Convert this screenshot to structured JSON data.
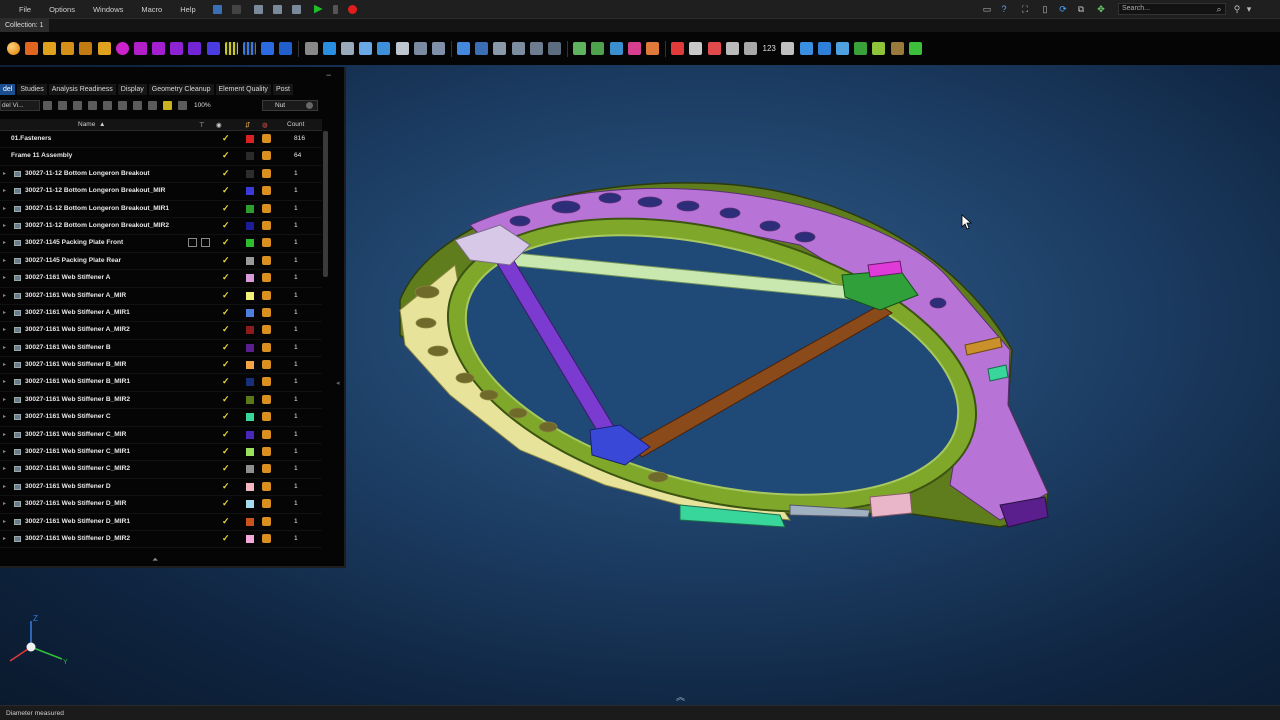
{
  "menu": {
    "file": "File",
    "options": "Options",
    "windows": "Windows",
    "macro": "Macro",
    "help": "Help"
  },
  "search": {
    "placeholder": "Search..."
  },
  "collection": {
    "label": "Collection: 1"
  },
  "panel": {
    "tabs": [
      "del",
      "Studies",
      "Analysis Readiness",
      "Display",
      "Geometry Cleanup",
      "Element Quality",
      "Post"
    ],
    "view_select": "del Vi...",
    "zoom": "100%",
    "filter_value": "Nut",
    "columns": {
      "name": "Name",
      "count": "Count"
    },
    "rows": [
      {
        "name": "01.Fasteners",
        "count": "816",
        "color": "#d8221f",
        "top": true
      },
      {
        "name": "Frame 11 Assembly",
        "count": "64",
        "color": "#2a2a2a",
        "top": true
      },
      {
        "name": "30027-11-12 Bottom Longeron Breakout",
        "count": "1",
        "color": "#2d2d2d"
      },
      {
        "name": "30027-11-12 Bottom Longeron Breakout_MIR",
        "count": "1",
        "color": "#3a3ad8"
      },
      {
        "name": "30027-11-12 Bottom Longeron Breakout_MIR1",
        "count": "1",
        "color": "#2f9c2f"
      },
      {
        "name": "30027-11-12 Bottom Longeron Breakout_MIR2",
        "count": "1",
        "color": "#1d1d9a"
      },
      {
        "name": "30027-1145 Packing Plate Front",
        "count": "1",
        "color": "#2fbd2f",
        "extra": true
      },
      {
        "name": "30027-1145 Packing Plate Rear",
        "count": "1",
        "color": "#9a9a9a"
      },
      {
        "name": "30027-1161 Web Stiffener A",
        "count": "1",
        "color": "#d79bd9"
      },
      {
        "name": "30027-1161 Web Stiffener A_MIR",
        "count": "1",
        "color": "#f2f07a"
      },
      {
        "name": "30027-1161 Web Stiffener A_MIR1",
        "count": "1",
        "color": "#4e7fdc"
      },
      {
        "name": "30027-1161 Web Stiffener A_MIR2",
        "count": "1",
        "color": "#8a1c1c"
      },
      {
        "name": "30027-1161 Web Stiffener B",
        "count": "1",
        "color": "#5a1f8c"
      },
      {
        "name": "30027-1161 Web Stiffener B_MIR",
        "count": "1",
        "color": "#f2a446"
      },
      {
        "name": "30027-1161 Web Stiffener B_MIR1",
        "count": "1",
        "color": "#18307a"
      },
      {
        "name": "30027-1161 Web Stiffener B_MIR2",
        "count": "1",
        "color": "#5a7a1a"
      },
      {
        "name": "30027-1161 Web Stiffener C",
        "count": "1",
        "color": "#39d69c"
      },
      {
        "name": "30027-1161 Web Stiffener C_MIR",
        "count": "1",
        "color": "#4a27b8"
      },
      {
        "name": "30027-1161 Web Stiffener C_MIR1",
        "count": "1",
        "color": "#9be05a"
      },
      {
        "name": "30027-1161 Web Stiffener C_MIR2",
        "count": "1",
        "color": "#8f8f8f"
      },
      {
        "name": "30027-1161 Web Stiffener D",
        "count": "1",
        "color": "#f4b6c1"
      },
      {
        "name": "30027-1161 Web Stiffener D_MIR",
        "count": "1",
        "color": "#a6dcef"
      },
      {
        "name": "30027-1161 Web Stiffener D_MIR1",
        "count": "1",
        "color": "#c9531b"
      },
      {
        "name": "30027-1161 Web Stiffener D_MIR2",
        "count": "1",
        "color": "#f5a9d8"
      }
    ]
  },
  "triad": {
    "z": "Z",
    "y": "Y"
  },
  "toolbar": {
    "number_label": "123"
  },
  "status": {
    "message": "Diameter measured"
  },
  "colors": {
    "accent": "#1b4e8e",
    "frame_green": "#6f8f1e",
    "frame_purple": "#b774d6",
    "frame_yellow": "#e8e39a",
    "strut_purple": "#7b3ad0",
    "strut_brown": "#8a4a1a",
    "strut_pale": "#c8e8b0"
  }
}
